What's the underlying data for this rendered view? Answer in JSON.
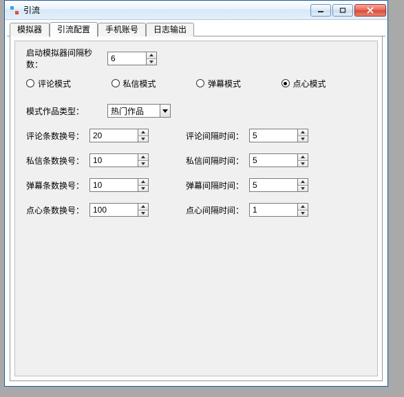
{
  "window": {
    "title": "引流"
  },
  "tabs": [
    {
      "label": "模拟器",
      "active": false
    },
    {
      "label": "引流配置",
      "active": true
    },
    {
      "label": "手机账号",
      "active": false
    },
    {
      "label": "日志输出",
      "active": false
    }
  ],
  "form": {
    "start_interval_label": "启动模拟器间隔秒数：",
    "start_interval_value": "6",
    "modes": {
      "comment": "评论模式",
      "dm": "私信模式",
      "danmu": "弹幕模式",
      "like": "点心模式",
      "selected": "like"
    },
    "work_type_label": "模式作品类型：",
    "work_type_value": "热门作品",
    "rows": {
      "comment_switch_label": "评论条数换号：",
      "comment_switch_value": "20",
      "comment_gap_label": "评论间隔时间：",
      "comment_gap_value": "5",
      "dm_switch_label": "私信条数换号：",
      "dm_switch_value": "10",
      "dm_gap_label": "私信间隔时间：",
      "dm_gap_value": "5",
      "danmu_switch_label": "弹幕条数换号：",
      "danmu_switch_value": "10",
      "danmu_gap_label": "弹幕间隔时间：",
      "danmu_gap_value": "5",
      "like_switch_label": "点心条数换号：",
      "like_switch_value": "100",
      "like_gap_label": "点心间隔时间：",
      "like_gap_value": "1"
    }
  }
}
